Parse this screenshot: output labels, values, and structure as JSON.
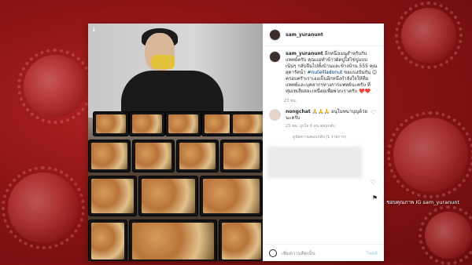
{
  "post": {
    "username": "sam_yuranunt",
    "caption_user": "sam_yuranunt",
    "caption_text": "อีกหนึ่งเมนูสำหรับกับแพทย์ครับ คุณแม่ทำข้าวผัดปูใส่ไข่ปูแบบเน้นๆ กลับจีนไปทั้งบ้านและข้างบ้าน 555 คุณสุดารัตน์ํา",
    "caption_tag": "#nutellladonut",
    "caption_tail": "ขอแบ่งปันกัน 😊 ครอบครัวเราเองเป็นอีกหนึ่งกำลังใจให้ทีมแพทย์และบุคลากรทางการแพทย์นะครับ ที่ทุ่มเทเสียสละเหนื่อยเพื่อพวกเราครับ ❤️❤️",
    "caption_meta": "23 ชม.",
    "comment_user": "nongchat",
    "comment_text": "🙏🙏🙏 อนุโมทนาบุญด้วยนะครับ",
    "comment_meta": "23 ชม.   ถูกใจ 6 คน   ตอบกลับ",
    "replies": "ดูข้อความตอบกลับ (1 รายการ)",
    "add_comment": "เพิ่มความคิดเห็น",
    "post_button": "โพสต์",
    "credit": "ขอบคุณภาพ IG sam_yuranunt",
    "download_icon": "↓"
  },
  "colors": {
    "background_red": "#8e1414",
    "link_blue": "#00376b",
    "post_button": "#b2dffc"
  }
}
